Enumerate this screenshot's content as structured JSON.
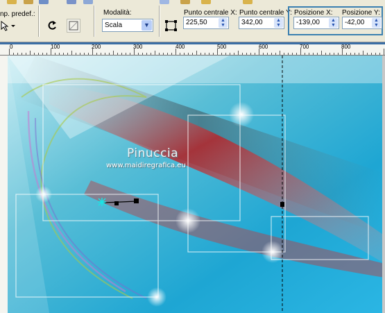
{
  "toolbar": {
    "preset_label": "np. predef.:",
    "mode_label": "Modalità:",
    "mode_value": "Scala",
    "center_x_label": "Punto centrale X:",
    "center_x_value": "225,50",
    "center_y_label": "Punto centrale Y:",
    "center_y_value": "342,00",
    "pos_x_label": "Posizione X:",
    "pos_x_value": "-139,00",
    "pos_y_label": "Posizione Y:",
    "pos_y_value": "-42,00"
  },
  "ruler": {
    "labels": [
      "0",
      "100",
      "200",
      "300",
      "400",
      "500",
      "600",
      "700",
      "800"
    ]
  },
  "watermark": {
    "title": "Pinuccia",
    "url": "www.maidiregrafica.eu"
  },
  "colors": {
    "highlight_box": "#3a7fb0",
    "sky": "#2ab4e0",
    "red_streak": "#b5262b"
  }
}
